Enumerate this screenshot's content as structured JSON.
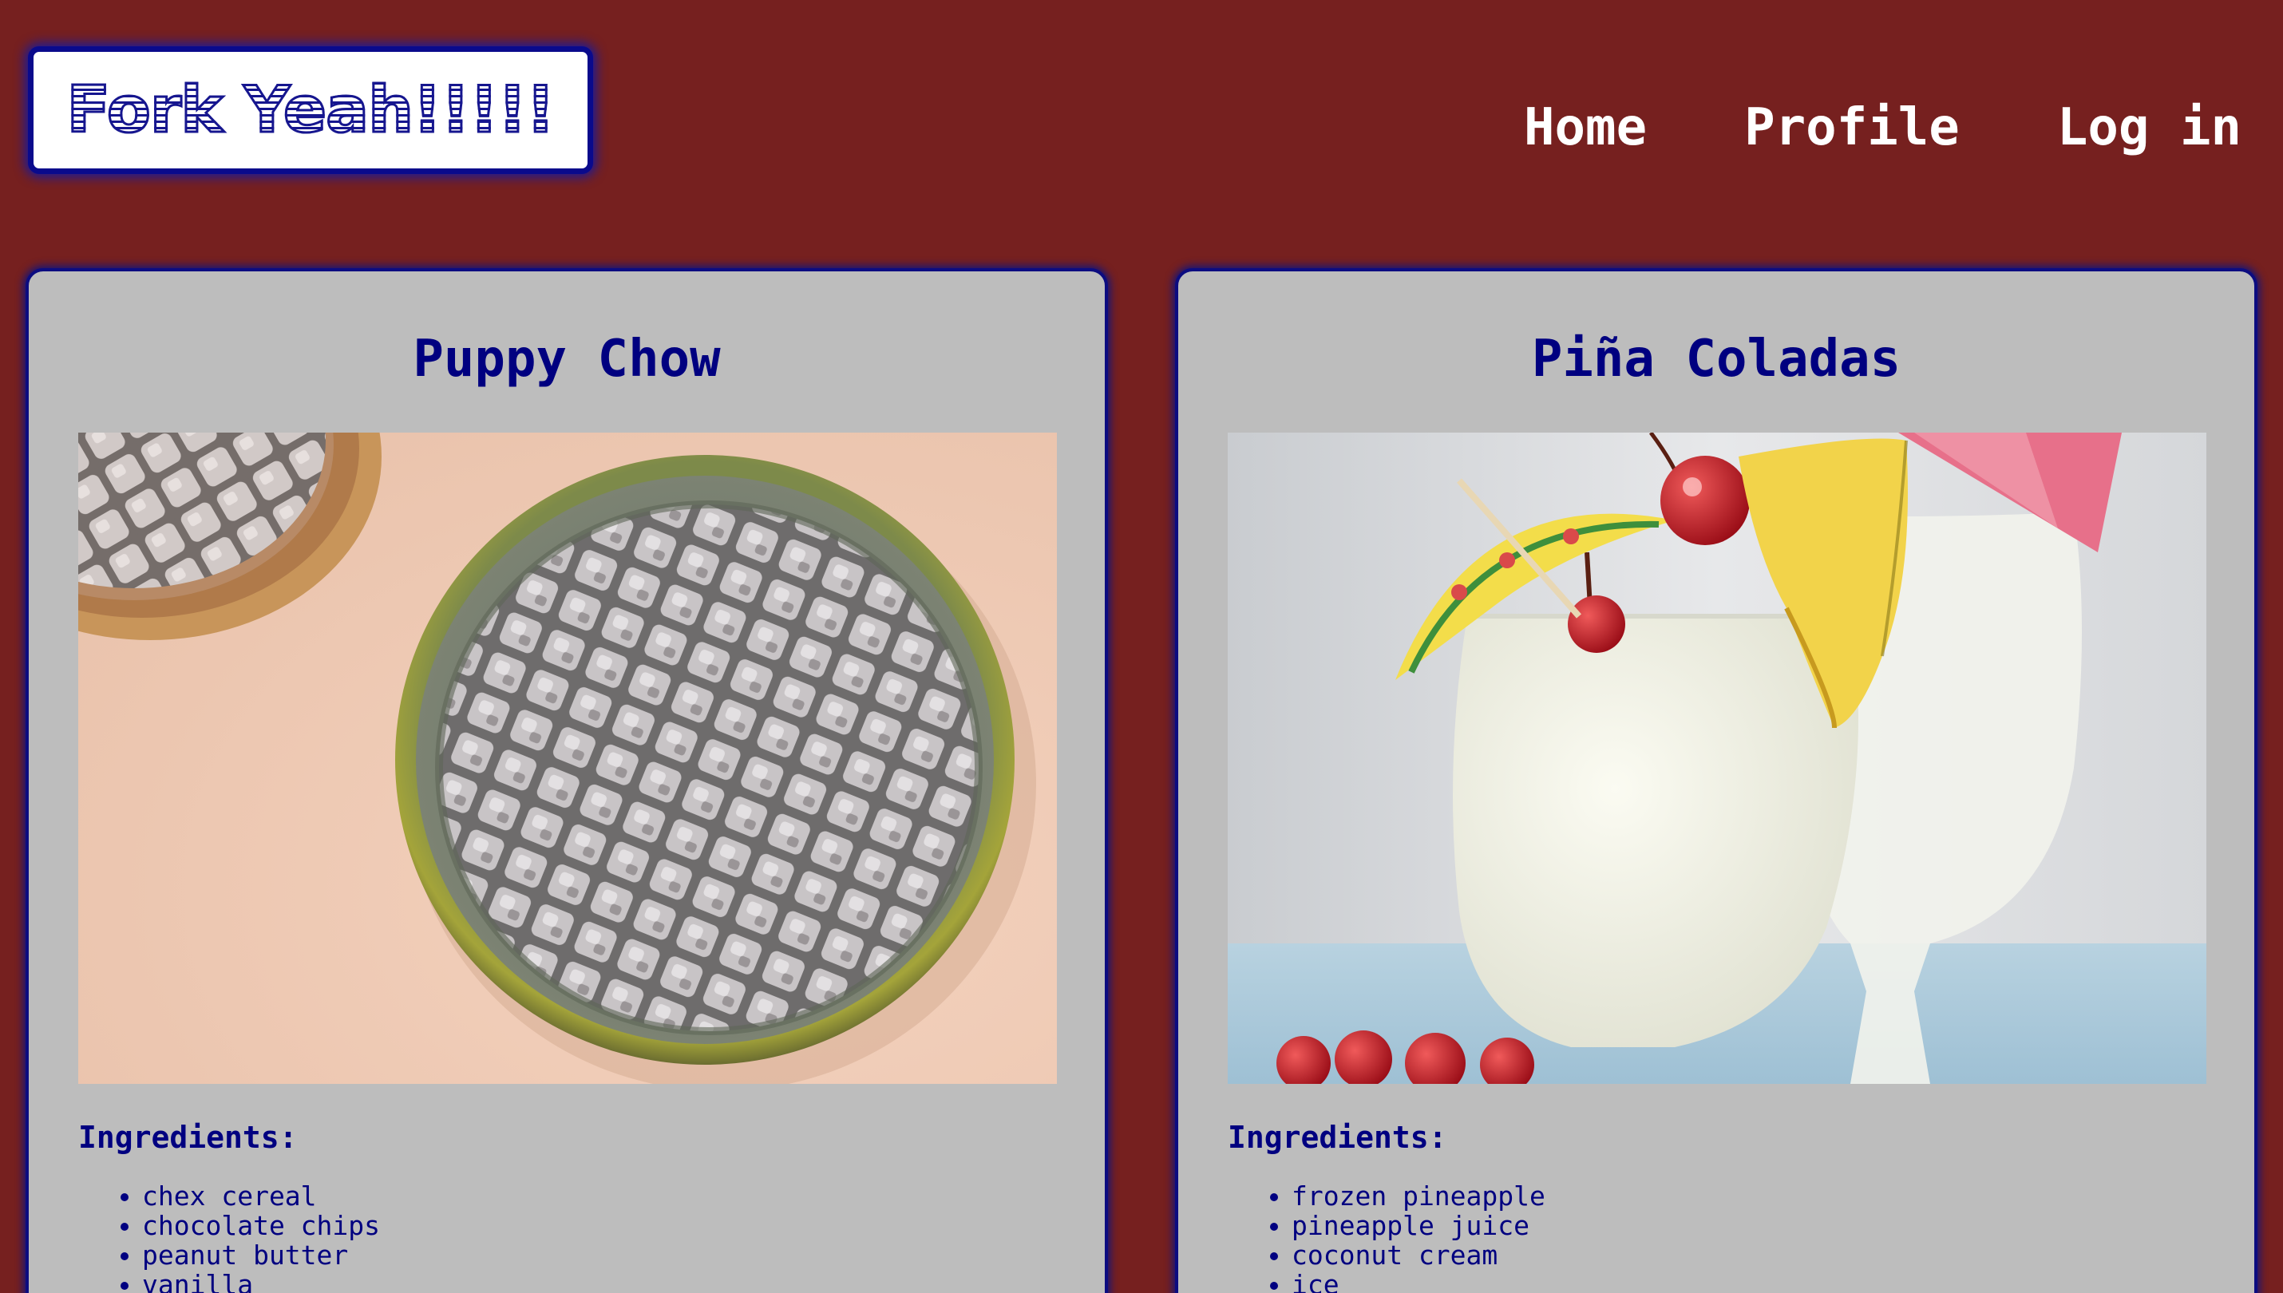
{
  "header": {
    "logo_text": "Fork Yeah!!!!!",
    "nav": [
      {
        "label": "Home"
      },
      {
        "label": "Profile"
      },
      {
        "label": "Log in"
      }
    ]
  },
  "recipes": [
    {
      "title": "Puppy Chow",
      "image_icon": "puppy-chow-photo",
      "ingredients_heading": "Ingredients:",
      "ingredients": [
        "chex cereal",
        "chocolate chips",
        "peanut butter",
        "vanilla"
      ]
    },
    {
      "title": "Piña Coladas",
      "image_icon": "pina-colada-photo",
      "ingredients_heading": "Ingredients:",
      "ingredients": [
        "frozen pineapple",
        "pineapple juice",
        "coconut cream",
        "ice"
      ]
    }
  ],
  "colors": {
    "page_background": "#76201f",
    "card_background": "#bdbdbd",
    "accent_navy": "#000080",
    "nav_text": "#ffffff"
  }
}
